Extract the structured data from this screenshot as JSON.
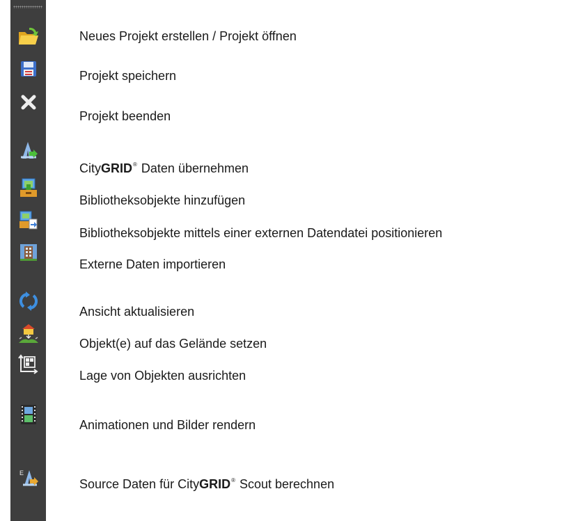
{
  "toolbar": {
    "items": [
      {
        "icon": "open-folder-icon",
        "label": "Neues Projekt erstellen / Projekt öffnen"
      },
      {
        "icon": "save-disk-icon",
        "label": "Projekt speichern"
      },
      {
        "icon": "close-x-icon",
        "label": "Projekt beenden"
      },
      {
        "icon": "citygrid-import-icon",
        "label_prefix": "City",
        "label_brand": "GRID",
        "label_reg": "®",
        "label_suffix": " Daten übernehmen"
      },
      {
        "icon": "library-add-icon",
        "label": "Bibliotheksobjekte hinzufügen"
      },
      {
        "icon": "library-position-icon",
        "label": "Bibliotheksobjekte mittels einer externen Datendatei positionieren"
      },
      {
        "icon": "building-import-icon",
        "label": "Externe Daten importieren"
      },
      {
        "icon": "refresh-icon",
        "label": "Ansicht aktualisieren"
      },
      {
        "icon": "place-on-terrain-icon",
        "label": "Objekt(e) auf das Gelände setzen"
      },
      {
        "icon": "align-objects-icon",
        "label": "Lage von Objekten ausrichten"
      },
      {
        "icon": "film-render-icon",
        "label": "Animationen und Bilder rendern"
      },
      {
        "icon": "scout-export-icon",
        "label_prefix": "Source Daten für City",
        "label_brand": "GRID",
        "label_reg": "®",
        "label_suffix": " Scout berechnen"
      }
    ]
  },
  "colors": {
    "toolbar_bg": "#3e3e3e",
    "text": "#1a1a1a"
  }
}
